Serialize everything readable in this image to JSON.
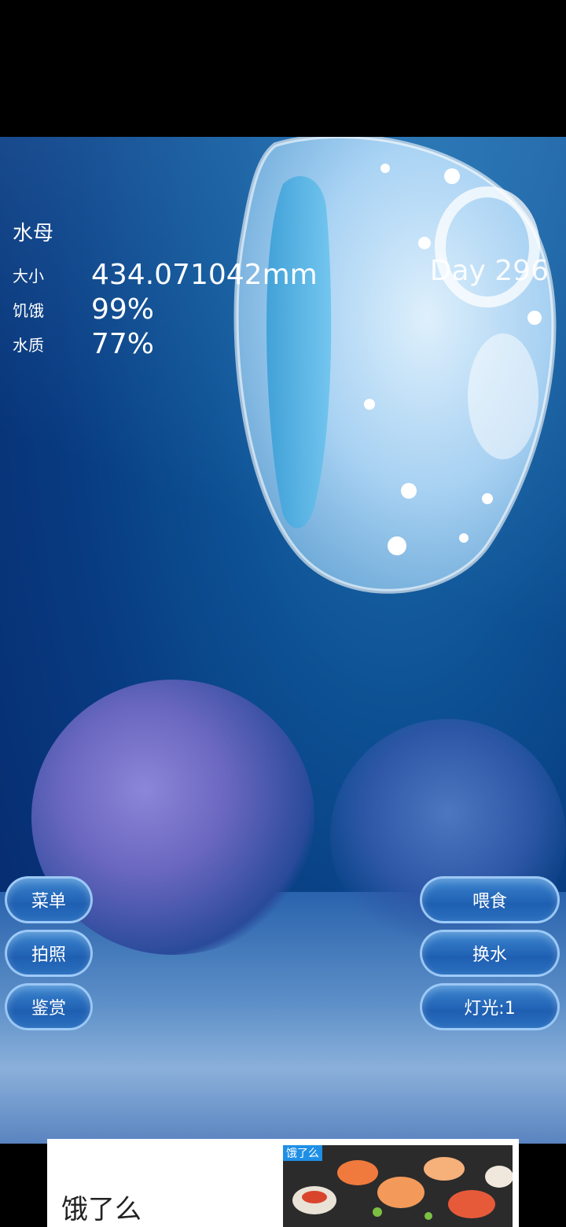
{
  "hud": {
    "name": "水母",
    "size_label": "大小",
    "size_value": "434.071042mm",
    "hunger_label": "饥饿",
    "hunger_value": "99%",
    "water_label": "水质",
    "water_value": "77%",
    "day": "Day 296"
  },
  "buttons_left": [
    "菜单",
    "拍照",
    "鉴赏"
  ],
  "buttons_right": [
    "喂食",
    "换水",
    "灯光:1"
  ],
  "ad": {
    "title": "饿了么",
    "logo_text": "饿了么"
  },
  "colors": {
    "water": "#0c4f92",
    "button": "#1f5fb2",
    "button_border": "#afd7ff"
  }
}
